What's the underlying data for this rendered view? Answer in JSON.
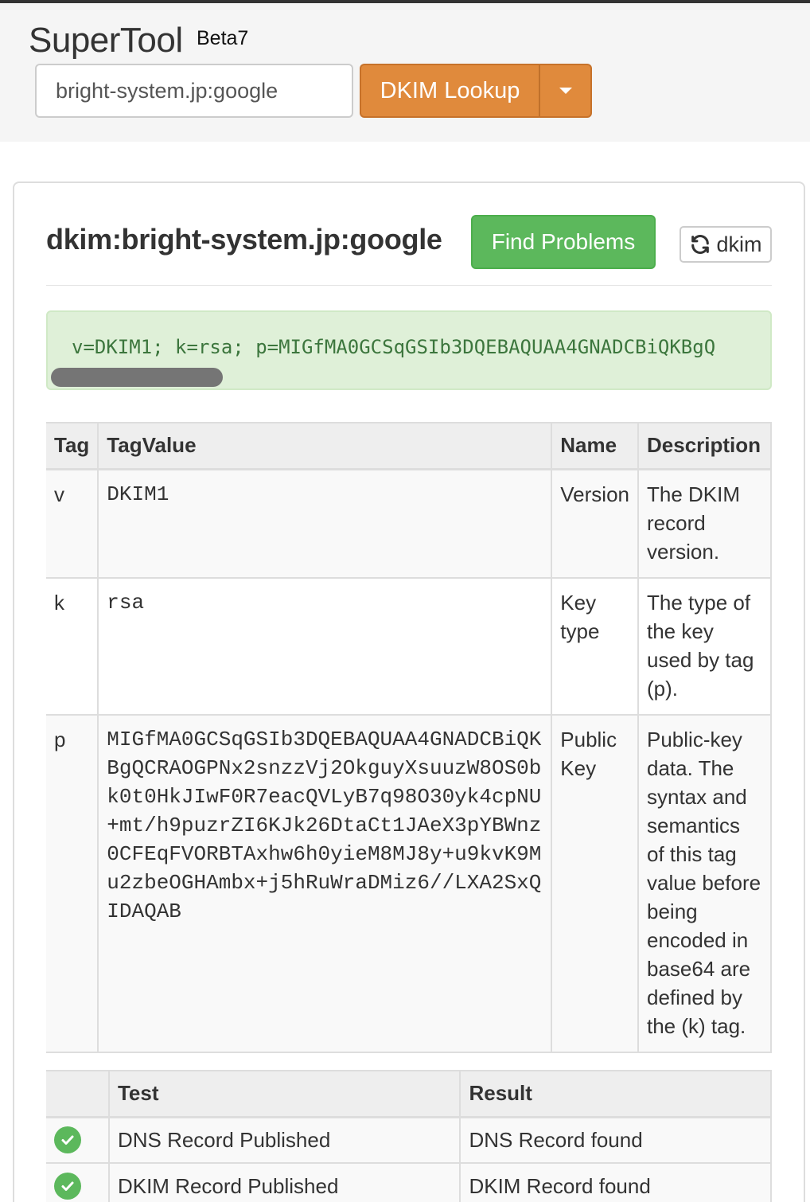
{
  "app": {
    "brand": "SuperTool",
    "badge": "Beta7"
  },
  "search": {
    "value": "bright-system.jp:google",
    "lookup_label": "DKIM Lookup"
  },
  "record": {
    "title": "dkim:bright-system.jp:google",
    "find_problems_label": "Find Problems",
    "refresh_label": "dkim",
    "raw_text": "v=DKIM1; k=rsa; p=MIGfMA0GCSqGSIb3DQEBAQUAA4GNADCBiQKBgQ"
  },
  "tag_table": {
    "headers": [
      "Tag",
      "TagValue",
      "Name",
      "Description"
    ],
    "rows": [
      {
        "tag": "v",
        "value": "DKIM1",
        "name": "Version",
        "description": "The DKIM record version."
      },
      {
        "tag": "k",
        "value": "rsa",
        "name": "Key type",
        "description": "The type of the key used by tag (p)."
      },
      {
        "tag": "p",
        "value": "MIGfMA0GCSqGSIb3DQEBAQUAA4GNADCBiQKBgQCRAOGPNx2snzzVj2OkguyXsuuzW8OS0bk0t0HkJIwF0R7eacQVLyB7q98O30yk4cpNU+mt/h9puzrZI6KJk26DtaCt1JAeX3pYBWnz0CFEqFVORBTAxhw6h0yieM8MJ8y+u9kvK9Mu2zbeOGHAmbx+j5hRuWraDMiz6//LXA2SxQIDAQAB",
        "name": "Public Key",
        "description": "Public-key data. The syntax and semantics of this tag value before being encoded in base64 are defined by the (k) tag."
      }
    ]
  },
  "test_table": {
    "headers": [
      "",
      "Test",
      "Result"
    ],
    "rows": [
      {
        "test": "DNS Record Published",
        "result": "DNS Record found",
        "status_icon": "check-circle-icon"
      },
      {
        "test": "DKIM Record Published",
        "result": "DKIM Record found",
        "status_icon": "check-circle-icon"
      }
    ]
  },
  "colors": {
    "accent_orange": "#e08a3c",
    "success_green": "#5cb85c",
    "record_bg": "#dff0d8",
    "record_text": "#3c763d"
  }
}
